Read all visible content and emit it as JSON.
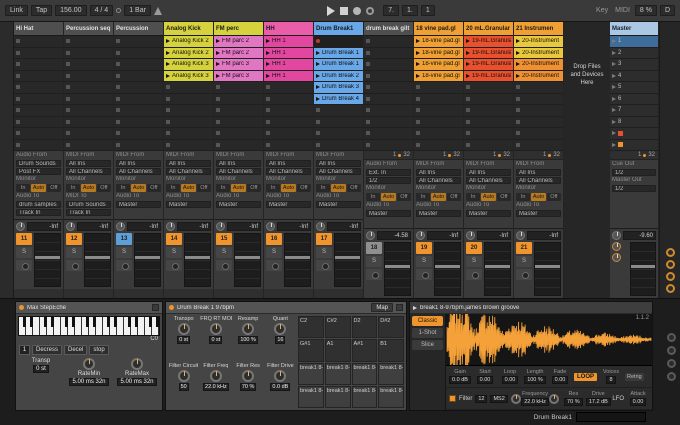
{
  "topbar": {
    "link": "Link",
    "tap": "Tap",
    "tempo": "156.00",
    "sig": "4 / 4",
    "quantize": "1 Bar",
    "pos_bar": "7.",
    "pos_beat": "1.",
    "pos_six": "1",
    "key": "Key",
    "midi": "MIDI",
    "cpu": "8 %",
    "disk": "D"
  },
  "labels": {
    "monitor": "Monitor",
    "mon_in": "In",
    "mon_auto": "Auto",
    "mon_off": "Off",
    "solo": "S"
  },
  "session": {
    "drop": [
      "Drop Files",
      "and Devices",
      "Here"
    ],
    "tracks": [
      {
        "name": "Hi Hat",
        "hbg": "#4f4f4f",
        "hfg": "#e0e0e0",
        "clips": [
          {},
          {},
          {},
          {},
          {},
          {},
          {},
          {},
          {},
          {}
        ],
        "routing": {
          "in_label": "Audio From",
          "in_value": "Drum Sounds",
          "in_ch": "Post FX",
          "out_label": "Audio To",
          "out_value": "drum samples",
          "out_ch": "Track In"
        },
        "mixer": {
          "db": "-Inf",
          "num": "11",
          "num_bg": "#f0942d"
        }
      },
      {
        "name": "Percussion seq",
        "hbg": "#4f4f4f",
        "hfg": "#e0e0e0",
        "clips": [
          {},
          {},
          {},
          {},
          {},
          {},
          {},
          {},
          {},
          {}
        ],
        "routing": {
          "in_label": "MIDI From",
          "in_value": "All Ins",
          "in_ch": "All Channels",
          "out_label": "MIDI To",
          "out_value": "Drum Sounds",
          "out_ch": "Track In"
        },
        "mixer": {
          "db": "-Inf",
          "num": "12",
          "num_bg": "#f0942d"
        }
      },
      {
        "name": "Percussion",
        "hbg": "#4f4f4f",
        "hfg": "#e0e0e0",
        "clips": [
          {},
          {},
          {},
          {},
          {},
          {},
          {},
          {},
          {},
          {}
        ],
        "routing": {
          "in_label": "MIDI From",
          "in_value": "All Ins",
          "in_ch": "All Channels",
          "out_label": "Audio To",
          "out_value": "Master"
        },
        "mixer": {
          "db": "-Inf",
          "num": "13",
          "num_bg": "#5f9fd8"
        }
      },
      {
        "name": "Analog Kick",
        "hbg": "#d6d23e",
        "hfg": "#1a1a1a",
        "clips": [
          {
            "label": "Analog Kick 2",
            "bg": "#d6d23e"
          },
          {
            "label": "Analog Kick 2",
            "bg": "#d6d23e"
          },
          {
            "label": "Analog Kick 3",
            "bg": "#d6d23e"
          },
          {
            "label": "Analog Kick 3",
            "bg": "#d6d23e"
          },
          {},
          {},
          {},
          {},
          {},
          {}
        ],
        "routing": {
          "in_label": "MIDI From",
          "in_value": "All Ins",
          "in_ch": "All Channels",
          "out_label": "Audio To",
          "out_value": "Master"
        },
        "mixer": {
          "db": "-Inf",
          "num": "14",
          "num_bg": "#f0942d"
        }
      },
      {
        "name": "FM perc",
        "hbg": "#d6d23e",
        "hfg": "#1a1a1a",
        "clips": [
          {
            "label": "FM parc 2",
            "bg": "#e176c3"
          },
          {
            "label": "FM parc 2",
            "bg": "#e176c3"
          },
          {
            "label": "FM parc 3",
            "bg": "#e176c3"
          },
          {
            "label": "FM parc 3",
            "bg": "#e176c3"
          },
          {},
          {},
          {},
          {},
          {},
          {}
        ],
        "routing": {
          "in_label": "MIDI From",
          "in_value": "All Ins",
          "in_ch": "All Channels",
          "out_label": "Audio To",
          "out_value": "Master"
        },
        "mixer": {
          "db": "-Inf",
          "num": "15",
          "num_bg": "#f0942d"
        }
      },
      {
        "name": "HH",
        "hbg": "#ea5da8",
        "hfg": "#1a1a1a",
        "clips": [
          {
            "label": "HH 1",
            "bg": "#e2479f"
          },
          {
            "label": "HH 1",
            "bg": "#e2479f"
          },
          {
            "label": "HH 1",
            "bg": "#e2479f"
          },
          {
            "label": "HH 1",
            "bg": "#e2479f"
          },
          {},
          {},
          {},
          {},
          {},
          {}
        ],
        "routing": {
          "in_label": "MIDI From",
          "in_value": "All Ins",
          "in_ch": "All Channels",
          "out_label": "Audio To",
          "out_value": "Master"
        },
        "mixer": {
          "db": "-Inf",
          "num": "16",
          "num_bg": "#f0942d"
        }
      },
      {
        "name": "Drum Break1",
        "hbg": "#68a7e8",
        "hfg": "#1a1a1a",
        "clips": [
          {
            "rec": true,
            "bg": "#202020"
          },
          {
            "label": "Drum Break 1",
            "bg": "#68a7e8"
          },
          {
            "label": "Drum Break 1",
            "bg": "#68a7e8"
          },
          {
            "label": "Drum Break 2",
            "bg": "#68a7e8"
          },
          {
            "label": "Drum Break 3",
            "bg": "#68a7e8"
          },
          {
            "label": "Drum Break 4",
            "bg": "#68a7e8"
          },
          {},
          {},
          {},
          {}
        ],
        "routing": {
          "in_label": "MIDI From",
          "in_value": "All Ins",
          "in_ch": "All Channels",
          "out_label": "Audio To",
          "out_value": "Master"
        },
        "mixer": {
          "db": "-Inf",
          "num": "17",
          "num_bg": "#f0942d"
        }
      },
      {
        "name": "drum break gilt",
        "hbg": "#4f4f4f",
        "hfg": "#e0e0e0",
        "clips": [
          {},
          {},
          {},
          {},
          {},
          {},
          {},
          {},
          {},
          {}
        ],
        "routing": {
          "in_label": "Audio From",
          "in_value": "Ext. In",
          "in_ch": "1/2",
          "out_label": "Audio To",
          "out_value": "Master"
        },
        "mixer": {
          "db": "-4.58",
          "num": "18",
          "num_bg": "#8f8f8f"
        },
        "ind_l": "1",
        "ind_r": "32"
      },
      {
        "name": "18 vine pad.gl",
        "hbg": "#f0a033",
        "hfg": "#1a1a1a",
        "clips": [
          {
            "label": "18-vine pad.gl",
            "bg": "#f0a033"
          },
          {
            "label": "18-vine pad.gl",
            "bg": "#f0a033"
          },
          {
            "label": "18-vine pad.gl",
            "bg": "#f0a033"
          },
          {
            "label": "18-vine pad.gl",
            "bg": "#f0a033"
          },
          {},
          {},
          {},
          {},
          {},
          {}
        ],
        "routing": {
          "in_label": "MIDI From",
          "in_value": "All Ins",
          "in_ch": "All Channels",
          "out_label": "Audio To",
          "out_value": "Master"
        },
        "mixer": {
          "db": "-Inf",
          "num": "19",
          "num_bg": "#f0942d"
        },
        "ind_l": "1",
        "ind_r": "32"
      },
      {
        "name": "20 mL.Granular",
        "hbg": "#f0a033",
        "hfg": "#1a1a1a",
        "clips": [
          {
            "label": "19-mL.Granular",
            "bg": "#e8502e"
          },
          {
            "label": "19-mL.Granular",
            "bg": "#e8502e"
          },
          {
            "label": "19-mL.Granular",
            "bg": "#e8502e"
          },
          {
            "label": "19-mL.Granular",
            "bg": "#e8502e"
          },
          {},
          {},
          {},
          {},
          {},
          {}
        ],
        "routing": {
          "in_label": "MIDI From",
          "in_value": "All Ins",
          "in_ch": "All Channels",
          "out_label": "Audio To",
          "out_value": "Master"
        },
        "mixer": {
          "db": "-Inf",
          "num": "20",
          "num_bg": "#f0942d"
        },
        "ind_l": "1",
        "ind_r": "32"
      },
      {
        "name": "21 Instrumen",
        "hbg": "#f0a033",
        "hfg": "#1a1a1a",
        "clips": [
          {
            "label": "20-Instrument",
            "bg": "#e8c83c"
          },
          {
            "label": "20-Instrument",
            "bg": "#e8c83c"
          },
          {
            "label": "20-Instrument",
            "bg": "#ef9033"
          },
          {
            "label": "20-Instrument",
            "bg": "#ef9033"
          },
          {},
          {},
          {},
          {},
          {},
          {}
        ],
        "routing": {
          "in_label": "MIDI From",
          "in_value": "All Ins",
          "in_ch": "All Channels",
          "out_label": "Audio To",
          "out_value": "Master"
        },
        "mixer": {
          "db": "-Inf",
          "num": "21",
          "num_bg": "#f0942d"
        },
        "ind_l": "1",
        "ind_r": "32"
      }
    ],
    "master": {
      "name": "Master",
      "hbg": "#aac7e4",
      "hfg": "#16222e",
      "scenes": [
        {
          "label": "1",
          "bg": "#3e6c9b"
        },
        {
          "label": "2"
        },
        {
          "label": "3"
        },
        {
          "label": "4"
        },
        {
          "label": "5"
        },
        {
          "label": "6"
        },
        {
          "label": "7"
        },
        {
          "label": "8"
        },
        {
          "label": "",
          "marker": "#e8502e"
        },
        {
          "label": "",
          "marker": "#f0942d"
        }
      ],
      "ind_l": "1",
      "ind_r": "32",
      "routing": {
        "cue_label": "Cue Out",
        "cue_value": "1/2",
        "out_label": "Master Out",
        "out_value": "1/2"
      },
      "mixer": {
        "db": "-9.60"
      }
    }
  },
  "device_area": {
    "device1": {
      "title": "Max StepEche",
      "keyboard_note": "C0",
      "numbox": "1",
      "buttons": [
        "Decress",
        "Decel",
        "stop"
      ],
      "p1_label": "Transp",
      "p1_value": "0 st",
      "p2_label": "RateMin",
      "p2_v1": "5.00 ms",
      "p2_v2": "32n",
      "p3_label": "RateMax",
      "p3_v1": "5.00 ms",
      "p3_v2": "32n"
    },
    "device2": {
      "title": "Drum Break 1 97bpm",
      "map": "Map",
      "macros1": [
        {
          "label": "Transpo",
          "value": "0 st"
        },
        {
          "label": "FRQ RT MOD",
          "value": "0 st"
        },
        {
          "label": "Resamp",
          "value": "100 %"
        },
        {
          "label": "Quant",
          "value": "16"
        }
      ],
      "macros2": [
        {
          "label": "Filter Circuit",
          "value": "50"
        },
        {
          "label": "Filter Freq",
          "value": "22.0 kHz"
        },
        {
          "label": "Filter Res",
          "value": "70 %"
        },
        {
          "label": "Filter Drive",
          "value": "0.0 dB"
        }
      ],
      "pads": [
        {
          "label": "C2"
        },
        {
          "label": "C#2"
        },
        {
          "label": "D2"
        },
        {
          "label": "D#2"
        },
        {
          "label": "G#1"
        },
        {
          "label": "A1"
        },
        {
          "label": "A#1"
        },
        {
          "label": "B1"
        },
        {
          "label": "break1 8-9",
          "bg": "#3f3f3f"
        },
        {
          "label": "break1 8-9",
          "bg": "#3f3f3f"
        },
        {
          "label": "break1 8-9",
          "bg": "#3f3f3f"
        },
        {
          "label": "break1 8-9",
          "bg": "#3f3f3f"
        },
        {
          "label": "break1 8-9",
          "bg": "#3f3f3f"
        },
        {
          "label": "break1 8-9",
          "bg": "#3f3f3f"
        },
        {
          "label": "break1 8-9",
          "bg": "#3f3f3f"
        },
        {
          "label": "break1 8-9",
          "bg": "#3f3f3f"
        }
      ]
    },
    "device3": {
      "title": "break1 8-97bpm.james brown groove",
      "position": "1.1.2",
      "tabs": [
        {
          "label": "Classic",
          "bg": "#f0942d",
          "fg": "#141414"
        },
        {
          "label": "1-Shot"
        },
        {
          "label": "Slice"
        }
      ],
      "params": [
        {
          "label": "Gain",
          "value": "0.0 dB"
        },
        {
          "label": "Start",
          "value": "0.00"
        },
        {
          "label": "Loop",
          "value": "0.00"
        },
        {
          "label": "Length",
          "value": "100 %"
        },
        {
          "label": "Fade",
          "value": "0.00"
        }
      ],
      "loop": "LOOP",
      "voices_label": "Voices",
      "voices": "8",
      "retrig": "Retrig",
      "filter_label": "Filter",
      "slope": "12",
      "circuit": "MS2",
      "freq_label": "Frequency",
      "freq": "22.0 kHz",
      "res_label": "Res",
      "res": "70 %",
      "drive_label": "Drive",
      "drive": "17.2 dB",
      "lfo_label": "LFO",
      "attack_label": "Attack",
      "attack": "0.00"
    },
    "status_clip": "Drum Break1",
    "wave_color": "#f5a13a"
  }
}
